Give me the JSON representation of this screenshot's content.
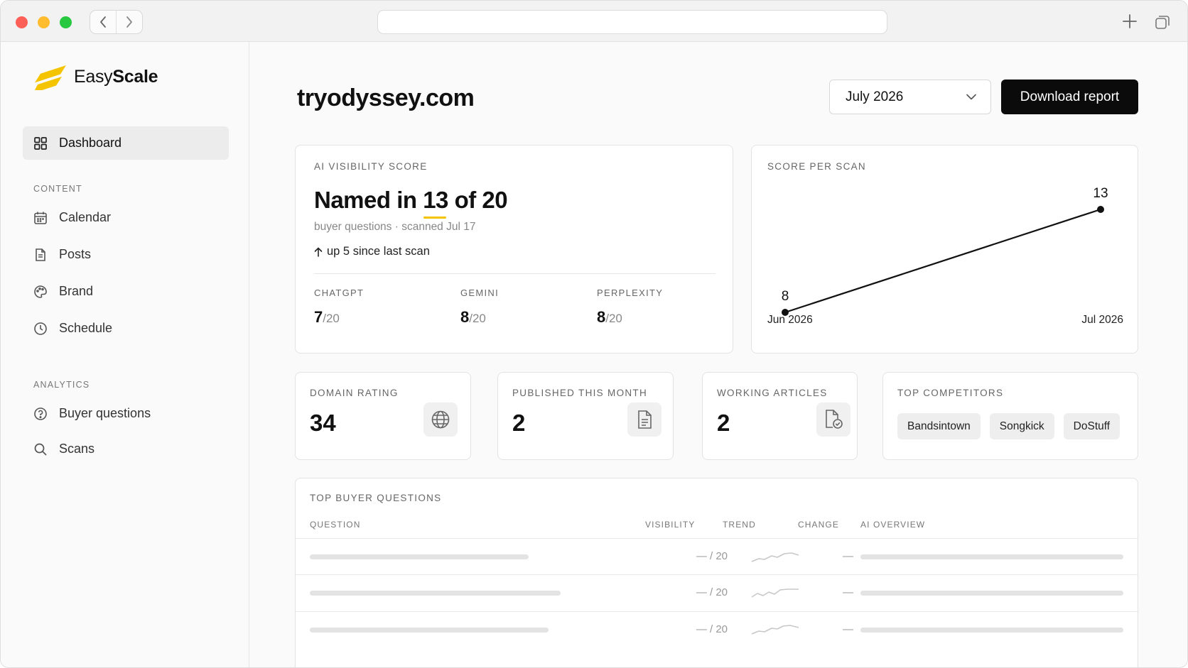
{
  "sidebar": {
    "brand_light": "Easy",
    "brand_bold": "Scale",
    "items_top": [
      {
        "label": "Dashboard"
      }
    ],
    "section_content": "CONTENT",
    "content_items": [
      {
        "label": "Calendar"
      },
      {
        "label": "Posts"
      },
      {
        "label": "Brand"
      },
      {
        "label": "Schedule"
      }
    ],
    "section_analytics": "ANALYTICS",
    "analytics_items": [
      {
        "label": "Buyer questions"
      },
      {
        "label": "Scans"
      }
    ]
  },
  "header": {
    "title": "tryodyssey.com",
    "month": "July 2026",
    "download_label": "Download report"
  },
  "visibility": {
    "label": "AI VISIBILITY SCORE",
    "headline": "Named in 13 of 20",
    "subtext": "buyer questions · scanned Jul 17",
    "trend": "up 5 since last scan",
    "engines": [
      {
        "label": "CHATGPT",
        "score": "7",
        "total": "/20"
      },
      {
        "label": "GEMINI",
        "score": "8",
        "total": "/20"
      },
      {
        "label": "PERPLEXITY",
        "score": "8",
        "total": "/20"
      }
    ]
  },
  "score_chart": {
    "label": "SCORE PER SCAN"
  },
  "chart_data": {
    "type": "line",
    "title": "SCORE PER SCAN",
    "x": [
      "Jun 2026",
      "Jul 2026"
    ],
    "series": [
      {
        "values": [
          8,
          13
        ]
      }
    ],
    "ylim": [
      0,
      20
    ],
    "grid": false
  },
  "stats": {
    "domain_rating": {
      "label": "DOMAIN RATING",
      "value": "34"
    },
    "published": {
      "label": "PUBLISHED THIS MONTH",
      "value": "2"
    },
    "working": {
      "label": "WORKING ARTICLES",
      "value": "2"
    },
    "competitors": {
      "label": "TOP COMPETITORS",
      "items": [
        "Bandsintown",
        "Songkick",
        "DoStuff"
      ]
    }
  },
  "questions": {
    "label": "TOP BUYER QUESTIONS",
    "columns": [
      "QUESTION",
      "VISIBILITY",
      "TREND",
      "CHANGE",
      "AI OVERVIEW"
    ],
    "rows": [
      {
        "visibility": "— / 20",
        "change": "—"
      },
      {
        "visibility": "— / 20",
        "change": "—"
      },
      {
        "visibility": "— / 20",
        "change": "—"
      }
    ]
  },
  "colors": {
    "accent": "#f5c400",
    "button": "#0b0b0b"
  }
}
